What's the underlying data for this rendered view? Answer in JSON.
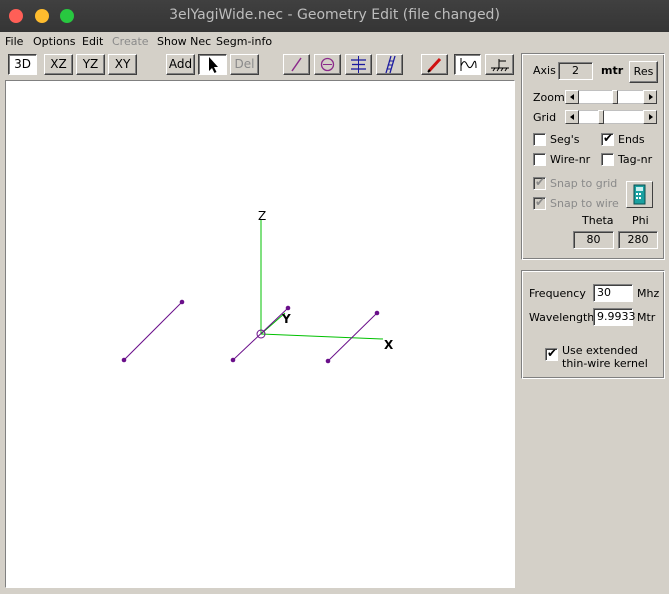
{
  "window": {
    "title": "3elYagiWide.nec - Geometry Edit (file changed)"
  },
  "menu": [
    {
      "label": "File",
      "disabled": false
    },
    {
      "label": "Options",
      "disabled": false
    },
    {
      "label": "Edit",
      "disabled": false
    },
    {
      "label": "Create",
      "disabled": true
    },
    {
      "label": "Show Nec",
      "disabled": false
    },
    {
      "label": "Segm-info",
      "disabled": false
    }
  ],
  "toolbar": {
    "view_3d": "3D",
    "view_xz": "XZ",
    "view_yz": "YZ",
    "view_xy": "XY",
    "add": "Add",
    "del": "Del",
    "icons": [
      "arrow-pointer-icon",
      "wire-icon",
      "loop-icon",
      "helix-icon",
      "ladder-icon",
      "pencil-icon",
      "source-wave-icon",
      "ground-icon"
    ]
  },
  "canvas": {
    "axis_labels": {
      "z": "Z",
      "y": "Y",
      "x": "X"
    },
    "colors": {
      "axis": "#00c000",
      "wire": "#6a0f8a",
      "axis_x": "#00c000"
    }
  },
  "panel": {
    "axis_label": "Axis",
    "axis_value": "2",
    "axis_unit": "mtr",
    "res_button": "Res",
    "zoom_label": "Zoom",
    "grid_label": "Grid",
    "checkboxes": {
      "segs": {
        "label": "Seg's",
        "checked": false
      },
      "ends": {
        "label": "Ends",
        "checked": true
      },
      "wire_nr": {
        "label": "Wire-nr",
        "checked": false
      },
      "tag_nr": {
        "label": "Tag-nr",
        "checked": false
      },
      "snap_grid": {
        "label": "Snap to grid",
        "checked": true,
        "disabled": true
      },
      "snap_wire": {
        "label": "Snap to wire",
        "checked": true,
        "disabled": true
      }
    },
    "theta_label": "Theta",
    "phi_label": "Phi",
    "theta_value": "80",
    "phi_value": "280"
  },
  "freq": {
    "frequency_label": "Frequency",
    "frequency_value": "30",
    "frequency_unit": "Mhz",
    "wavelength_label": "Wavelength",
    "wavelength_value": "9.9933",
    "wavelength_unit": "Mtr",
    "kernel_label_1": "Use extended",
    "kernel_label_2": "thin-wire kernel",
    "kernel_checked": true
  }
}
